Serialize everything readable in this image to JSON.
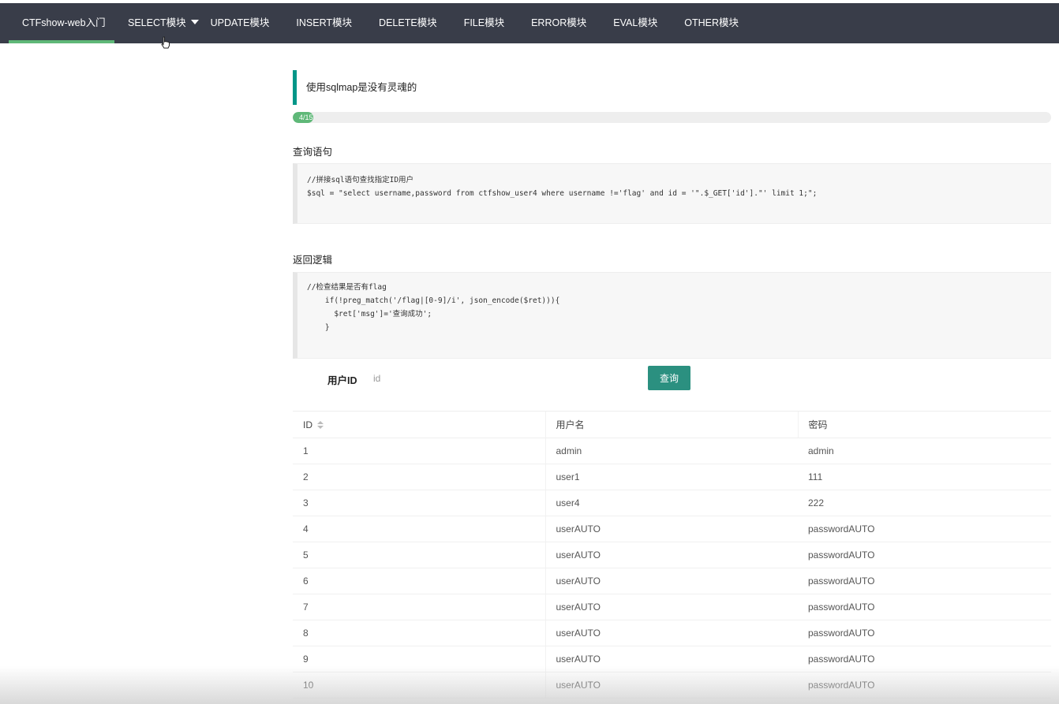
{
  "nav": {
    "items": [
      {
        "label": "CTFshow-web入门"
      },
      {
        "label": "SELECT模块"
      },
      {
        "label": "UPDATE模块"
      },
      {
        "label": "INSERT模块"
      },
      {
        "label": "DELETE模块"
      },
      {
        "label": "FILE模块"
      },
      {
        "label": "ERROR模块"
      },
      {
        "label": "EVAL模块"
      },
      {
        "label": "OTHER模块"
      }
    ],
    "active_color": "#5fb878",
    "bg_color": "#393d49"
  },
  "quote": {
    "text": "使用sqlmap是没有灵魂的"
  },
  "progress": {
    "label": "4/15",
    "fraction": 0.027
  },
  "query_section": {
    "title": "查询语句",
    "code_lines": [
      "//拼接sql语句查找指定ID用户",
      "$sql = \"select username,password from ctfshow_user4 where username !='flag' and id = '\".$_GET['id'].\"' limit 1;\";"
    ]
  },
  "return_section": {
    "title": "返回逻辑",
    "code_lines": [
      "//检查结果是否有flag",
      "    if(!preg_match('/flag|[0-9]/i', json_encode($ret))){",
      "      $ret['msg']='查询成功';",
      "    }"
    ]
  },
  "form": {
    "label": "用户ID",
    "placeholder": "id",
    "button_label": "查询",
    "button_color": "#2b9080"
  },
  "table": {
    "headers": [
      "ID",
      "用户名",
      "密码"
    ],
    "rows": [
      [
        "1",
        "admin",
        "admin"
      ],
      [
        "2",
        "user1",
        "111"
      ],
      [
        "3",
        "user4",
        "222"
      ],
      [
        "4",
        "userAUTO",
        "passwordAUTO"
      ],
      [
        "5",
        "userAUTO",
        "passwordAUTO"
      ],
      [
        "6",
        "userAUTO",
        "passwordAUTO"
      ],
      [
        "7",
        "userAUTO",
        "passwordAUTO"
      ],
      [
        "8",
        "userAUTO",
        "passwordAUTO"
      ],
      [
        "9",
        "userAUTO",
        "passwordAUTO"
      ],
      [
        "10",
        "userAUTO",
        "passwordAUTO"
      ]
    ]
  }
}
